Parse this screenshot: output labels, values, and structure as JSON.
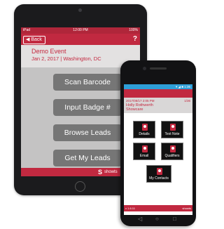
{
  "tablet": {
    "status": {
      "left": "iPad",
      "time": "12:00 PM",
      "right": "100%"
    },
    "nav": {
      "back_label": "◀ Back",
      "help_label": "?"
    },
    "event": {
      "name": "Demo Event",
      "subtitle": "Jan 2, 2017 | Washington, DC"
    },
    "buttons": [
      "Scan Barcode",
      "Input Badge #",
      "Browse Leads",
      "Get My Leads"
    ],
    "footer": {
      "logo_mark": "S",
      "logo_text": "showts"
    }
  },
  "phone": {
    "status": {
      "icons": "▾ ◢ ■ 1:36"
    },
    "lead": {
      "date": "2017/08/17 2:05 PM",
      "count": "1/36",
      "name": "Holly Rothwerth",
      "company": "Showcare"
    },
    "tiles": [
      {
        "label": "Details",
        "icon": "person-card-icon"
      },
      {
        "label": "Text Note",
        "icon": "pencil-icon"
      },
      {
        "label": "Email",
        "icon": "mail-icon"
      },
      {
        "label": "Qualifiers",
        "icon": "qualifiers-icon"
      },
      {
        "label": "My Contacts",
        "icon": "contacts-icon"
      }
    ],
    "footer": {
      "left": "v 1.6.11",
      "right": "showts"
    },
    "system_keys": {
      "back": "◁",
      "home": "○",
      "recent": "□"
    }
  },
  "colors": {
    "brand_red": "#c12940",
    "button_gray": "#767676",
    "status_blue": "#2e9fd8"
  }
}
